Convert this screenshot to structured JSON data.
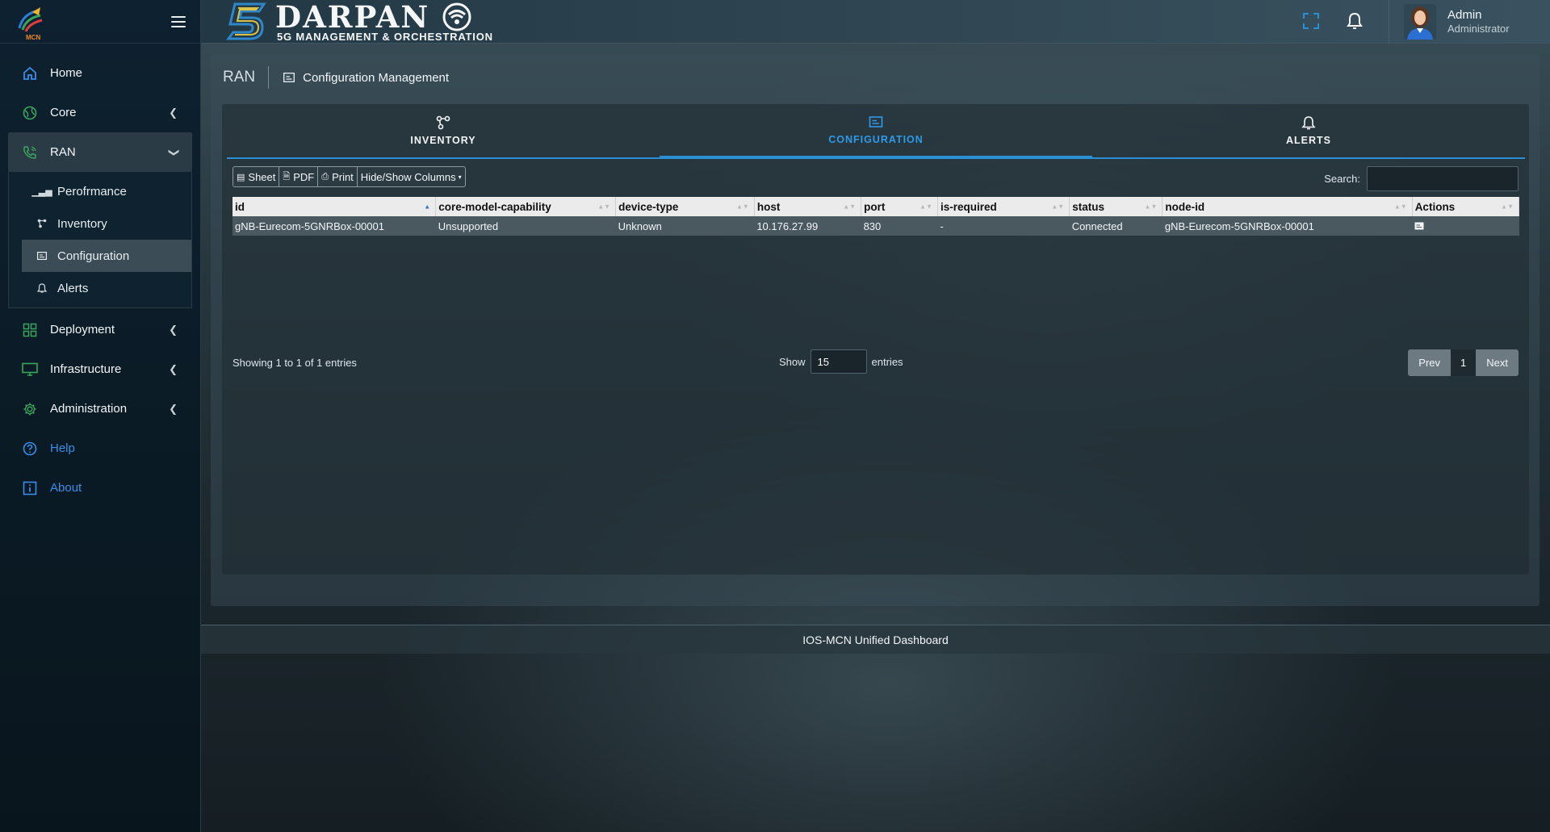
{
  "brand": {
    "mcn_text": "MCN"
  },
  "header": {
    "title": "DARPAN",
    "subtitle": "5G MANAGEMENT & ORCHESTRATION",
    "user_name": "Admin",
    "user_role": "Administrator"
  },
  "sidebar": {
    "items": [
      {
        "label": "Home",
        "icon": "home-icon"
      },
      {
        "label": "Core",
        "icon": "globe-icon"
      },
      {
        "label": "RAN",
        "icon": "phone-icon"
      },
      {
        "label": "Deployment",
        "icon": "grid-icon"
      },
      {
        "label": "Infrastructure",
        "icon": "monitor-icon"
      },
      {
        "label": "Administration",
        "icon": "gear-icon"
      },
      {
        "label": "Help",
        "icon": "question-icon"
      },
      {
        "label": "About",
        "icon": "info-icon"
      }
    ],
    "ran_sub": [
      {
        "label": "Perofrmance",
        "icon": "bar-chart-icon"
      },
      {
        "label": "Inventory",
        "icon": "network-icon"
      },
      {
        "label": "Configuration",
        "icon": "terminal-icon"
      },
      {
        "label": "Alerts",
        "icon": "alert-icon"
      }
    ]
  },
  "breadcrumb": {
    "root": "RAN",
    "page": "Configuration Management"
  },
  "tabs": [
    {
      "label": "INVENTORY",
      "icon": "network-icon"
    },
    {
      "label": "CONFIGURATION",
      "icon": "terminal-icon"
    },
    {
      "label": "ALERTS",
      "icon": "bell-icon"
    }
  ],
  "toolbar": {
    "sheet": "Sheet",
    "pdf": "PDF",
    "print": "Print",
    "columns": "Hide/Show Columns"
  },
  "search": {
    "label": "Search:",
    "value": ""
  },
  "table": {
    "columns": [
      "id",
      "core-model-capability",
      "device-type",
      "host",
      "port",
      "is-required",
      "status",
      "node-id",
      "Actions"
    ],
    "rows": [
      [
        "gNB-Eurecom-5GNRBox-00001",
        "Unsupported",
        "Unknown",
        "10.176.27.99",
        "830",
        "-",
        "Connected",
        "gNB-Eurecom-5GNRBox-00001",
        ""
      ]
    ]
  },
  "pagination": {
    "info": "Showing 1 to 1 of 1 entries",
    "show_label": "Show",
    "page_length": "15",
    "entries_label": "entries",
    "prev": "Prev",
    "current": "1",
    "next": "Next"
  },
  "footer": {
    "text": "IOS-MCN Unified Dashboard"
  },
  "colors": {
    "accent": "#2b8fd6",
    "link": "#3a8de8",
    "mcn_orange": "#f08a24"
  }
}
